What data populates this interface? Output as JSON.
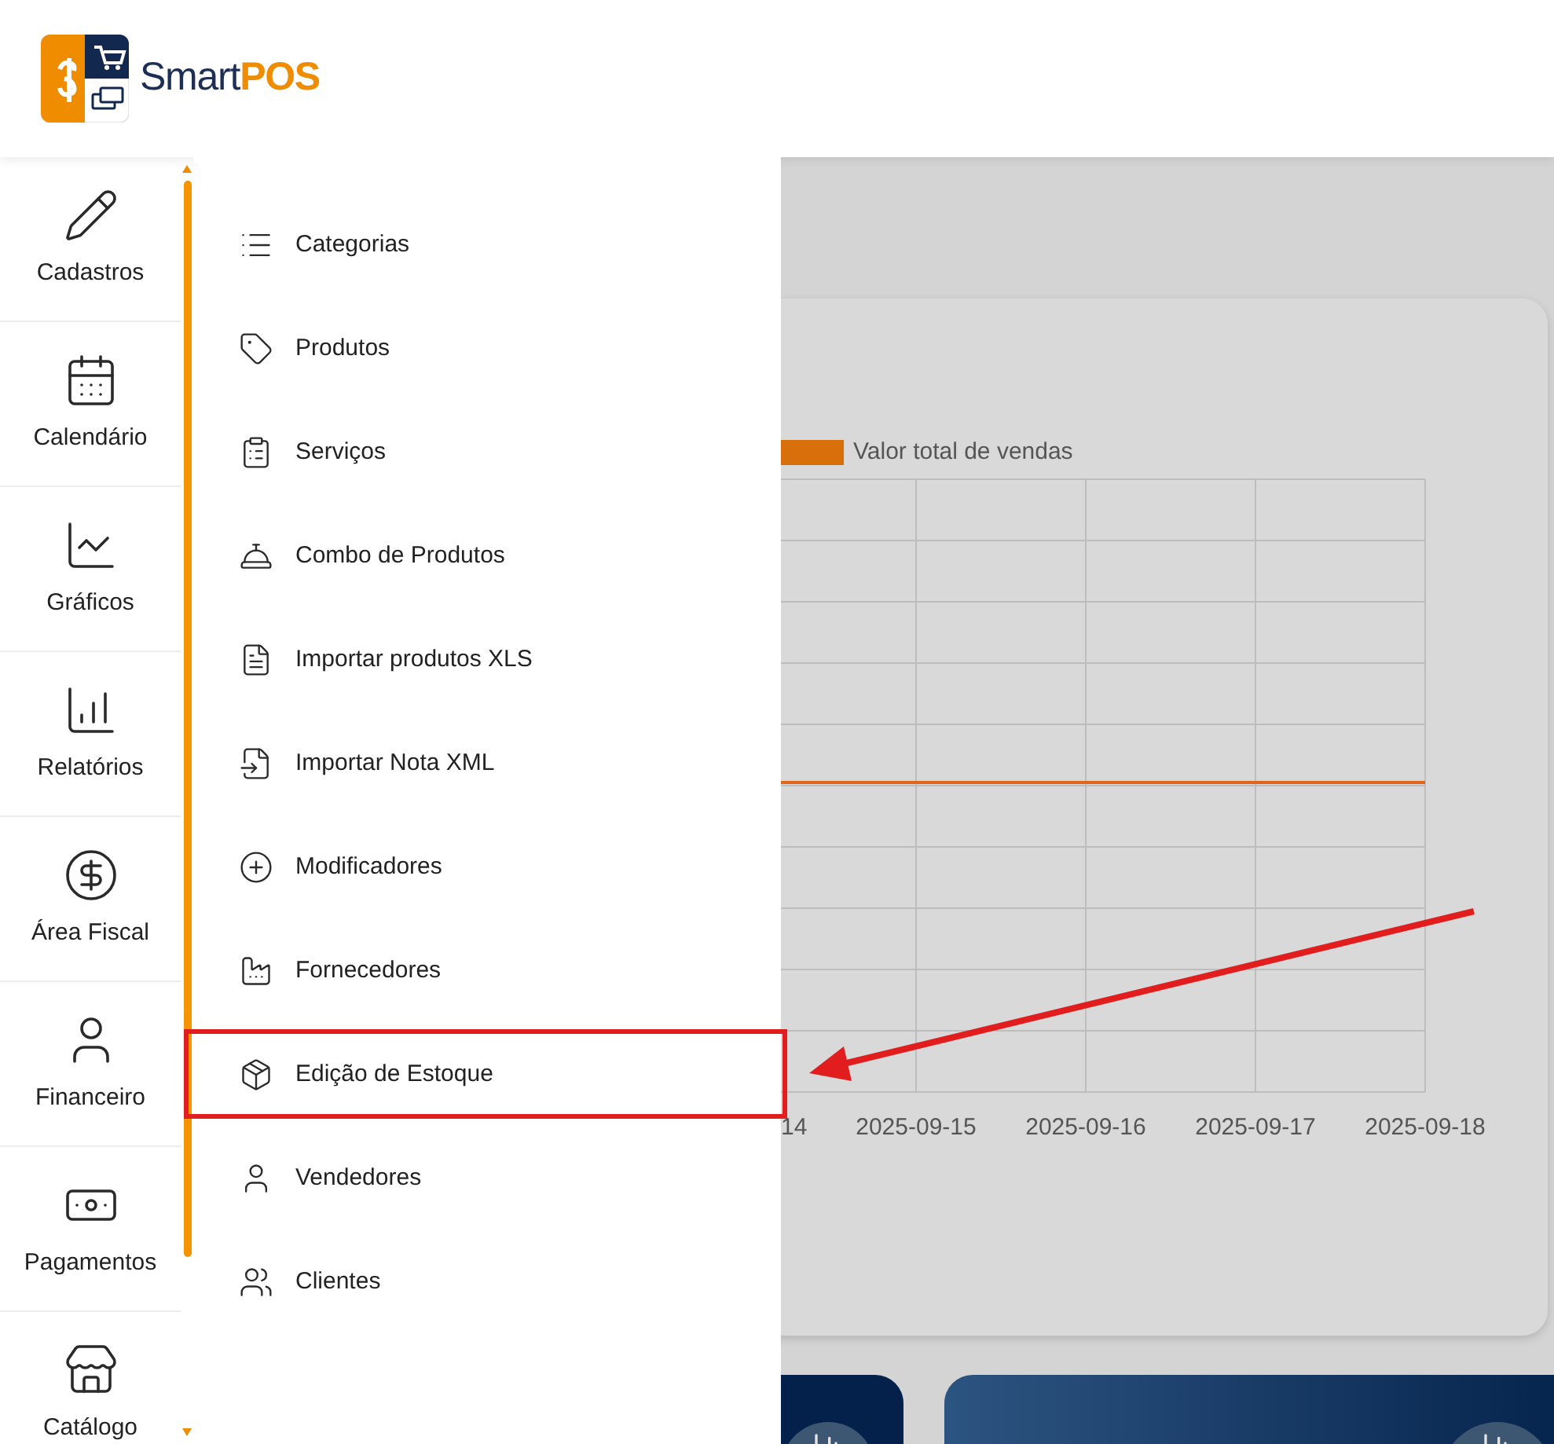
{
  "logo": {
    "brand": "Smart",
    "product": "POS"
  },
  "rail": [
    {
      "label": "Cadastros"
    },
    {
      "label": "Calendário"
    },
    {
      "label": "Gráficos"
    },
    {
      "label": "Relatórios"
    },
    {
      "label": "Área Fiscal"
    },
    {
      "label": "Financeiro"
    },
    {
      "label": "Pagamentos"
    },
    {
      "label": "Catálogo"
    }
  ],
  "submenu": [
    {
      "label": "Categorias",
      "highlighted": false
    },
    {
      "label": "Produtos",
      "highlighted": false
    },
    {
      "label": "Serviços",
      "highlighted": false
    },
    {
      "label": "Combo de Produtos",
      "highlighted": false
    },
    {
      "label": "Importar produtos XLS",
      "highlighted": false
    },
    {
      "label": "Importar Nota XML",
      "highlighted": false
    },
    {
      "label": "Modificadores",
      "highlighted": false
    },
    {
      "label": "Fornecedores",
      "highlighted": false
    },
    {
      "label": "Edição de Estoque",
      "highlighted": true
    },
    {
      "label": "Vendedores",
      "highlighted": false
    },
    {
      "label": "Clientes",
      "highlighted": false
    }
  ],
  "chart": {
    "legend": "Valor total de vendas",
    "x_labels": [
      "14",
      "2025-09-15",
      "2025-09-16",
      "2025-09-17",
      "2025-09-18"
    ]
  }
}
